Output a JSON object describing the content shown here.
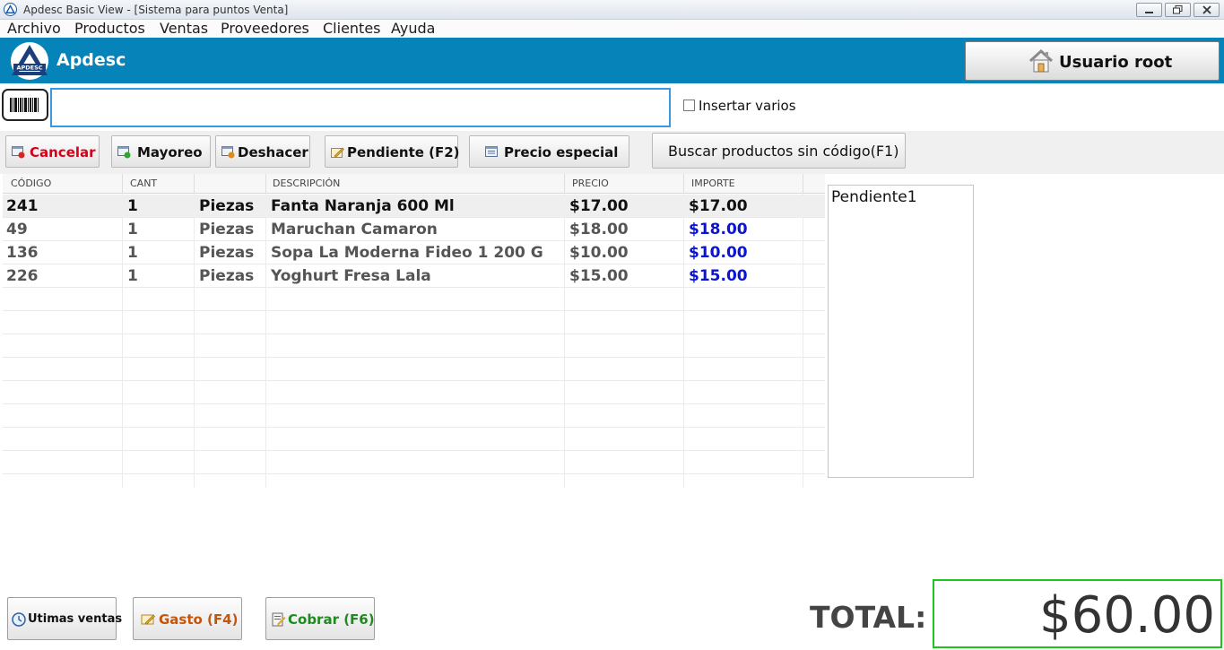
{
  "window": {
    "title": "Apdesc Basic View - [Sistema para puntos Venta]",
    "icon": "apdesc-logo-icon"
  },
  "menu": {
    "items": [
      {
        "label": "Archivo"
      },
      {
        "label": "Productos"
      },
      {
        "label": "Ventas"
      },
      {
        "label": "Proveedores"
      },
      {
        "label": "Clientes"
      },
      {
        "label": "Ayuda"
      }
    ]
  },
  "brand": {
    "name": "Apdesc",
    "logo_text": "APDESC",
    "bar_color": "#0684ba"
  },
  "user": {
    "label": "Usuario root",
    "icon": "house-icon"
  },
  "scan": {
    "input_value": "",
    "insert_multiple_label": "Insertar varios",
    "insert_multiple_checked": false
  },
  "toolbar": {
    "cancel": {
      "label": "Cancelar",
      "color": "#d4001a",
      "icon": "cancel-icon"
    },
    "wholesale": {
      "label": "Mayoreo",
      "color": "#111111",
      "icon": "wholesale-icon"
    },
    "undo": {
      "label": "Deshacer",
      "color": "#111111",
      "icon": "undo-icon"
    },
    "pending": {
      "label": "Pendiente (F2)",
      "color": "#111111",
      "icon": "pending-icon"
    },
    "special_price": {
      "label": "Precio especial",
      "color": "#111111",
      "icon": "special-price-icon"
    },
    "search_no_code": {
      "label": "Buscar productos sin código(F1)",
      "color": "#111111"
    }
  },
  "grid": {
    "headers": {
      "code": "CÓDIGO",
      "qty": "CANT",
      "unit": "",
      "description": "DESCRIPCIÓN",
      "price": "PRECIO",
      "amount": "IMPORTE"
    },
    "rows": [
      {
        "code": "241",
        "qty": "1",
        "unit": "Piezas",
        "description": "Fanta Naranja 600 Ml",
        "price": "$17.00",
        "amount": "$17.00",
        "selected": true
      },
      {
        "code": "49",
        "qty": "1",
        "unit": "Piezas",
        "description": "Maruchan Camaron",
        "price": "$18.00",
        "amount": "$18.00",
        "selected": false
      },
      {
        "code": "136",
        "qty": "1",
        "unit": "Piezas",
        "description": "Sopa La Moderna Fideo 1 200 G",
        "price": "$10.00",
        "amount": "$10.00",
        "selected": false
      },
      {
        "code": "226",
        "qty": "1",
        "unit": "Piezas",
        "description": "Yoghurt Fresa Lala",
        "price": "$15.00",
        "amount": "$15.00",
        "selected": false
      }
    ]
  },
  "pending_list": {
    "items": [
      "Pendiente1"
    ]
  },
  "bottom": {
    "last_sales": {
      "label": "Utimas ventas",
      "color": "#111111",
      "icon": "clock-icon"
    },
    "expense": {
      "label": "Gasto (F4)",
      "color": "#c2560e",
      "icon": "expense-icon"
    },
    "charge": {
      "label": "Cobrar (F6)",
      "color": "#1f8a1f",
      "icon": "charge-icon"
    }
  },
  "total": {
    "label": "TOTAL:",
    "value": "$60.00",
    "border_color": "#1fc41f"
  }
}
